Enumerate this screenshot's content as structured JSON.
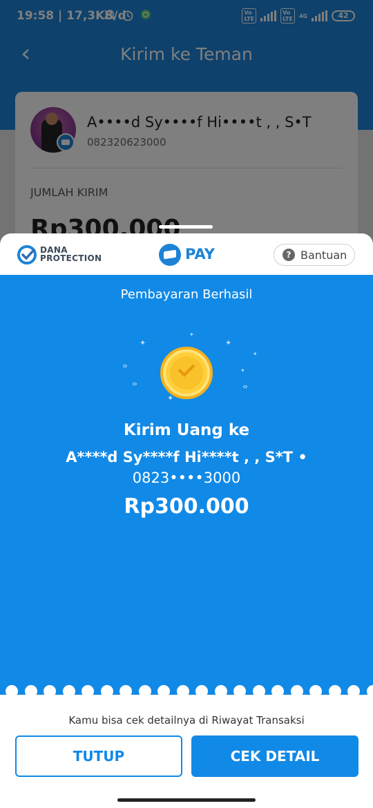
{
  "status_bar": {
    "time": "19:58 | 17,3KB/d",
    "icons": [
      "bell-muted-icon",
      "alarm-icon",
      "whatsapp-icon",
      "volte-icon",
      "signal-icon",
      "4g-icon",
      "battery-icon"
    ],
    "network_badge": "4G",
    "battery": "42"
  },
  "background_screen": {
    "title": "Kirim ke Teman",
    "recipient_name": "A••••d Sy••••f Hi••••t , , S•T",
    "recipient_phone": "082320623000",
    "amount_label": "JUMLAH KIRIM",
    "amount": "Rp300.000"
  },
  "sheet_header": {
    "protection_line1": "DANA",
    "protection_line2": "PROTECTION",
    "pay_label": "PAY",
    "help_label": "Bantuan"
  },
  "result": {
    "status": "Pembayaran Berhasil",
    "title": "Kirim Uang ke",
    "recipient": "A****d Sy****f Hi****t , , S*T •",
    "phone": "0823••••3000",
    "amount": "Rp300.000"
  },
  "footer": {
    "info": "Kamu bisa cek detailnya di Riwayat Transaksi",
    "close_label": "TUTUP",
    "detail_label": "CEK DETAIL"
  },
  "colors": {
    "primary": "#1189e6",
    "header": "#1c83d6",
    "coin": "#ffcf3a"
  }
}
